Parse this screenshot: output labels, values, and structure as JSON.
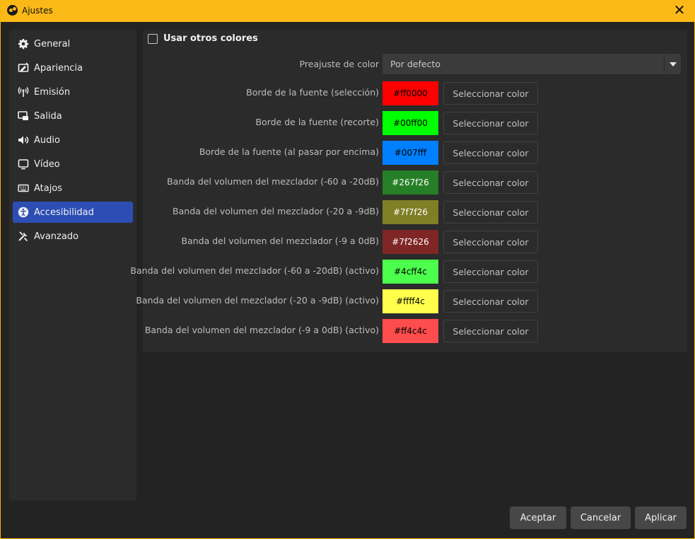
{
  "window": {
    "title": "Ajustes",
    "close_glyph": "✕"
  },
  "sidebar": {
    "items": [
      {
        "label": "General",
        "icon": "gear-icon"
      },
      {
        "label": "Apariencia",
        "icon": "appearance-icon"
      },
      {
        "label": "Emisión",
        "icon": "broadcast-icon"
      },
      {
        "label": "Salida",
        "icon": "output-icon"
      },
      {
        "label": "Audio",
        "icon": "speaker-icon"
      },
      {
        "label": "Vídeo",
        "icon": "monitor-icon"
      },
      {
        "label": "Atajos",
        "icon": "keyboard-icon"
      },
      {
        "label": "Accesibilidad",
        "icon": "accessibility-icon",
        "active": true
      },
      {
        "label": "Avanzado",
        "icon": "tools-icon"
      }
    ]
  },
  "accessibility": {
    "use_other_colors_label": "Usar otros colores",
    "use_other_colors_checked": false,
    "preset": {
      "label": "Preajuste de color",
      "value": "Por defecto"
    },
    "pick_button_label": "Seleccionar color",
    "rows": [
      {
        "label": "Borde de la fuente (selección)",
        "value": "#ff0000",
        "color": "#ff0000",
        "text_color": "#000000"
      },
      {
        "label": "Borde de la fuente (recorte)",
        "value": "#00ff00",
        "color": "#00ff00",
        "text_color": "#000000"
      },
      {
        "label": "Borde de la fuente (al pasar por encima)",
        "value": "#007fff",
        "color": "#007fff",
        "text_color": "#000000"
      },
      {
        "label": "Banda del volumen del mezclador (-60 a -20dB)",
        "value": "#267f26",
        "color": "#267f26",
        "text_color": "#ffffff"
      },
      {
        "label": "Banda del volumen del mezclador (-20 a -9dB)",
        "value": "#7f7f26",
        "color": "#7f7f26",
        "text_color": "#ffffff"
      },
      {
        "label": "Banda del volumen del mezclador (-9 a 0dB)",
        "value": "#7f2626",
        "color": "#7f2626",
        "text_color": "#ffffff"
      },
      {
        "label": "Banda del volumen del mezclador (-60 a -20dB) (activo)",
        "value": "#4cff4c",
        "color": "#4cff4c",
        "text_color": "#000000"
      },
      {
        "label": "Banda del volumen del mezclador (-20 a -9dB) (activo)",
        "value": "#ffff4c",
        "color": "#ffff4c",
        "text_color": "#000000"
      },
      {
        "label": "Banda del volumen del mezclador (-9 a 0dB) (activo)",
        "value": "#ff4c4c",
        "color": "#ff4c4c",
        "text_color": "#000000"
      }
    ]
  },
  "footer": {
    "accept": "Aceptar",
    "cancel": "Cancelar",
    "apply": "Aplicar"
  },
  "colors": {
    "titlebar": "#fbb918",
    "active_item": "#2d4db5",
    "panel": "#2b2b2b",
    "background": "#232323"
  }
}
